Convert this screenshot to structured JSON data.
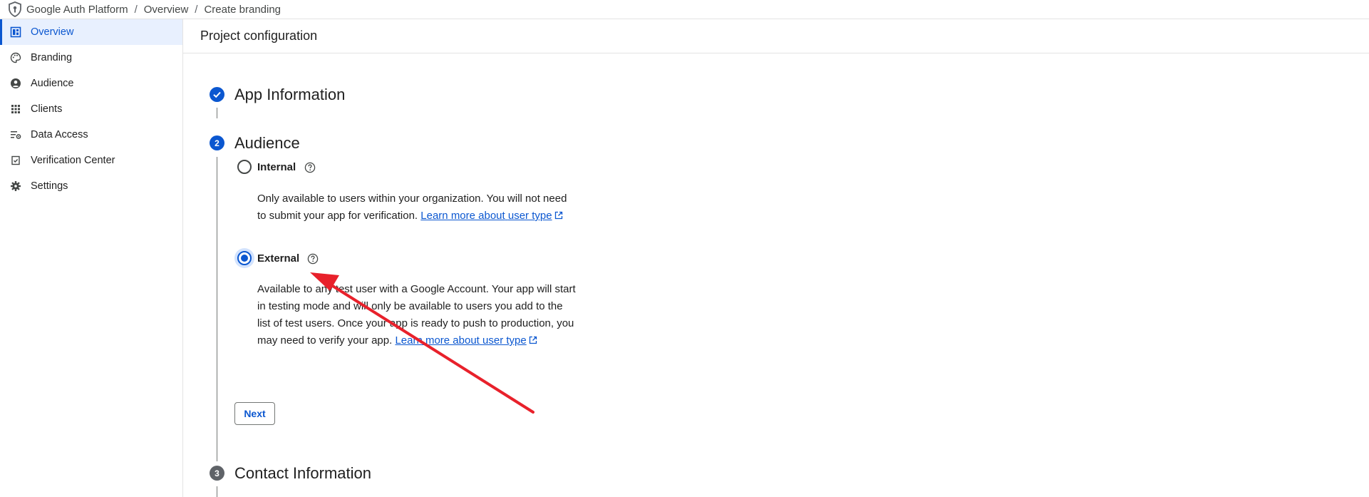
{
  "breadcrumb": {
    "items": [
      "Google Auth Platform",
      "Overview",
      "Create branding"
    ],
    "separator": "/"
  },
  "sidebar": {
    "items": [
      {
        "label": "Overview",
        "icon": "dashboard-icon",
        "active": true
      },
      {
        "label": "Branding",
        "icon": "palette-icon"
      },
      {
        "label": "Audience",
        "icon": "person-circle-icon"
      },
      {
        "label": "Clients",
        "icon": "grid-icon"
      },
      {
        "label": "Data Access",
        "icon": "list-settings-icon"
      },
      {
        "label": "Verification Center",
        "icon": "verified-doc-icon"
      },
      {
        "label": "Settings",
        "icon": "gear-icon"
      }
    ]
  },
  "page": {
    "title": "Project configuration"
  },
  "steps": [
    {
      "number": "1",
      "title": "App Information",
      "status": "completed"
    },
    {
      "number": "2",
      "title": "Audience",
      "status": "active"
    },
    {
      "number": "3",
      "title": "Contact Information",
      "status": "pending"
    }
  ],
  "audience": {
    "internal": {
      "label": "Internal",
      "selected": false,
      "description": "Only available to users within your organization. You will not need to submit your app for verification.",
      "link_line1": "Learn more about",
      "link_line2": "user type"
    },
    "external": {
      "label": "External",
      "selected": true,
      "description": "Available to any test user with a Google Account. Your app will start in testing mode and will only be available to users you add to the list of test users. Once your app is ready to push to production, you may need to verify your app.",
      "link_line1": "Learn more about",
      "link_line2": "user type"
    },
    "next_label": "Next"
  },
  "colors": {
    "accent": "#0b57d0",
    "active_bg": "#e8f0fe",
    "annotation": "#e8212b",
    "pending_step": "#5f6368"
  }
}
